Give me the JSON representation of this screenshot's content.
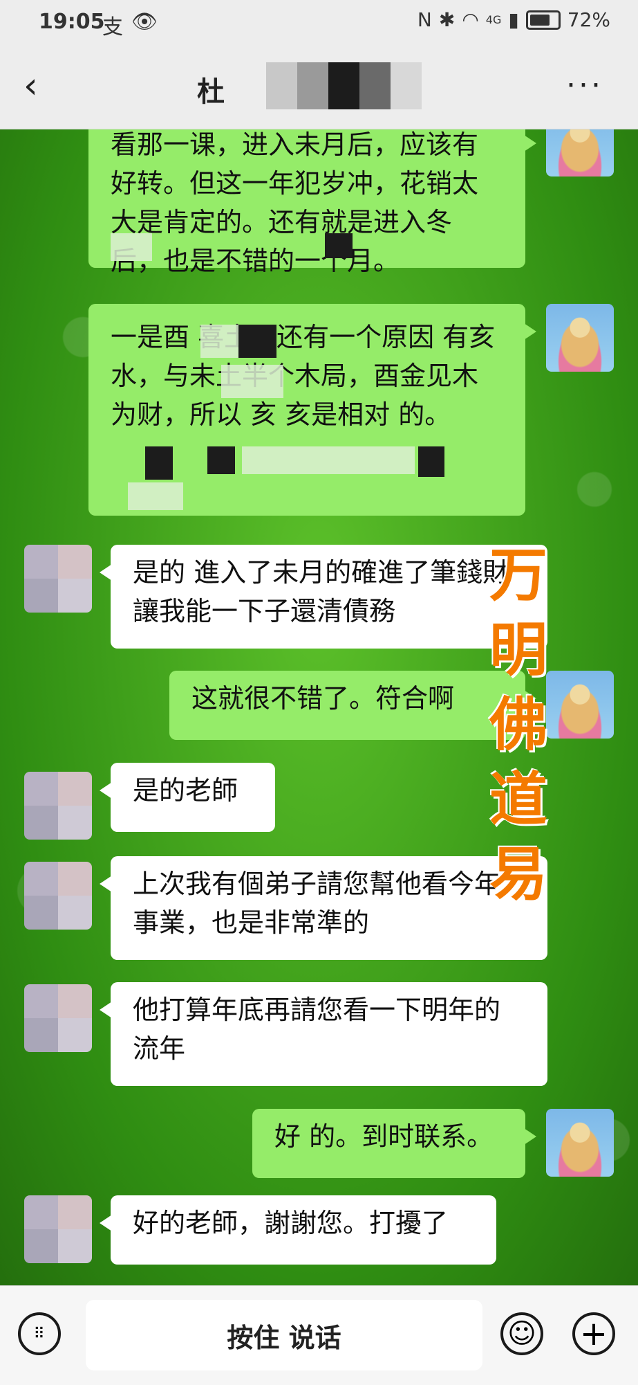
{
  "status_bar": {
    "time": "19:05",
    "left_icons": [
      "支",
      "👁"
    ],
    "network": "4G",
    "battery": "72%"
  },
  "header": {
    "title_visible": "杜",
    "back_label": "‹",
    "more_label": "···"
  },
  "messages": [
    {
      "side": "out",
      "text": "看那一课，进入未月后，应该有好转。但这一年犯岁冲，花销太大是肯定的。还有就是进入冬后，也是不错的一个月。"
    },
    {
      "side": "out",
      "text": "一是酉 喜土，还有一个原因 有亥水，与未土半个木局，酉金见木为财，所以 亥 亥是相对 的。"
    },
    {
      "side": "in",
      "text": "是的 進入了未月的確進了筆錢財 讓我能一下子還清債務"
    },
    {
      "side": "out",
      "text": "这就很不错了。符合啊"
    },
    {
      "side": "in",
      "text": "是的老師"
    },
    {
      "side": "in",
      "text": "上次我有個弟子請您幫他看今年事業，也是非常準的"
    },
    {
      "side": "in",
      "text": "他打算年底再請您看一下明年的流年"
    },
    {
      "side": "out",
      "text": "好 的。到时联系。"
    },
    {
      "side": "in",
      "text": "好的老師，謝謝您。打擾了"
    }
  ],
  "watermark": "万明佛道易",
  "input_bar": {
    "voice_label": "按住 说话",
    "keyboard_icon": "keyboard-icon",
    "emoji_icon": "emoji-icon",
    "plus_icon": "plus-icon"
  }
}
